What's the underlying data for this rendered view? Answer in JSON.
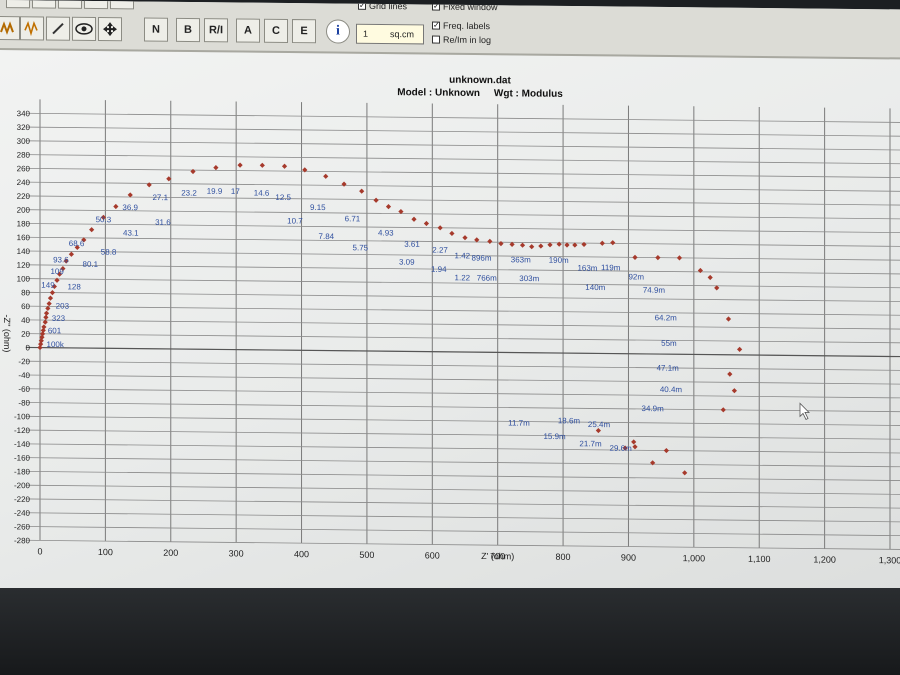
{
  "toolbar": {
    "unit_value": "1",
    "unit_label": "sq.cm",
    "grid_lines_label": "Grid lines",
    "fixed_window_label": "Fixed window",
    "freq_labels_label": "Freq. labels",
    "reim_log_label": "Re/Im in log",
    "button_labels": [
      "N",
      "B",
      "R/I",
      "A",
      "C",
      "E"
    ],
    "info_label": "i"
  },
  "chart_data": {
    "type": "scatter",
    "title": "unknown.dat",
    "subtitle": "Model : Unknown     Wgt : Modulus",
    "xlabel": "Z' (ohm)",
    "ylabel": "-Z'' (ohm)",
    "xlim": [
      0,
      1300
    ],
    "ylim": [
      -280,
      340
    ],
    "grid": true,
    "marker_color": "#a63a2c",
    "label_color": "#2f4f9f",
    "xticks": [
      "0",
      "100",
      "200",
      "300",
      "400",
      "500",
      "600",
      "700",
      "800",
      "900",
      "1,000",
      "1,100",
      "1,200",
      "1,300"
    ],
    "yticks": [
      "340",
      "320",
      "300",
      "280",
      "260",
      "240",
      "220",
      "200",
      "180",
      "160",
      "140",
      "120",
      "100",
      "80",
      "60",
      "40",
      "20",
      "0",
      "-20",
      "-40",
      "-60",
      "-80",
      "-100",
      "-120",
      "-140",
      "-160",
      "-180",
      "-200",
      "-220",
      "-240",
      "-260",
      "-280"
    ],
    "points": [
      [
        0,
        0
      ],
      [
        1,
        5
      ],
      [
        2,
        10
      ],
      [
        3,
        15
      ],
      [
        4,
        20
      ],
      [
        5,
        25
      ],
      [
        6,
        30
      ],
      [
        8,
        37
      ],
      [
        9,
        44
      ],
      [
        10,
        50
      ],
      [
        12,
        57
      ],
      [
        14,
        64
      ],
      [
        16,
        72
      ],
      [
        19,
        80
      ],
      [
        22,
        89
      ],
      [
        26,
        98
      ],
      [
        30,
        107
      ],
      [
        35,
        115
      ],
      [
        40,
        126
      ],
      [
        48,
        136
      ],
      [
        57,
        146
      ],
      [
        67,
        157
      ],
      [
        79,
        172
      ],
      [
        97,
        190
      ],
      [
        116,
        206
      ],
      [
        138,
        223
      ],
      [
        167,
        238
      ],
      [
        197,
        247
      ],
      [
        234,
        258
      ],
      [
        269,
        264
      ],
      [
        306,
        268
      ],
      [
        340,
        268
      ],
      [
        374,
        267
      ],
      [
        405,
        262
      ],
      [
        437,
        253
      ],
      [
        465,
        242
      ],
      [
        492,
        232
      ],
      [
        514,
        219
      ],
      [
        533,
        210
      ],
      [
        552,
        203
      ],
      [
        572,
        192
      ],
      [
        591,
        186
      ],
      [
        612,
        180
      ],
      [
        630,
        172
      ],
      [
        650,
        166
      ],
      [
        668,
        163
      ],
      [
        688,
        161
      ],
      [
        705,
        158
      ],
      [
        722,
        157
      ],
      [
        738,
        156
      ],
      [
        752,
        154
      ],
      [
        766,
        155
      ],
      [
        780,
        157
      ],
      [
        794,
        158
      ],
      [
        806,
        157
      ],
      [
        818,
        157
      ],
      [
        832,
        158
      ],
      [
        860,
        160
      ],
      [
        876,
        161
      ],
      [
        910,
        140
      ],
      [
        945,
        140
      ],
      [
        978,
        140
      ],
      [
        1010,
        122
      ],
      [
        1025,
        112
      ],
      [
        1035,
        97
      ],
      [
        1053,
        52
      ],
      [
        1070,
        8
      ],
      [
        1055,
        -28
      ],
      [
        1062,
        -52
      ],
      [
        1045,
        -80
      ],
      [
        854,
        -112
      ],
      [
        895,
        -137
      ],
      [
        908,
        -128
      ],
      [
        910,
        -135
      ],
      [
        937,
        -158
      ],
      [
        958,
        -140
      ],
      [
        986,
        -172
      ]
    ],
    "data_labels": [
      {
        "text": "100k",
        "x": 10,
        "y": 1
      },
      {
        "text": "601",
        "x": 12,
        "y": 21
      },
      {
        "text": "323",
        "x": 18,
        "y": 39
      },
      {
        "text": "203",
        "x": 24,
        "y": 57
      },
      {
        "text": "149",
        "x": 2,
        "y": 87
      },
      {
        "text": "128",
        "x": 42,
        "y": 85
      },
      {
        "text": "109",
        "x": 16,
        "y": 107
      },
      {
        "text": "93.6",
        "x": 20,
        "y": 124
      },
      {
        "text": "80.1",
        "x": 65,
        "y": 118
      },
      {
        "text": "68.6",
        "x": 44,
        "y": 148
      },
      {
        "text": "58.8",
        "x": 93,
        "y": 136
      },
      {
        "text": "50.3",
        "x": 85,
        "y": 183
      },
      {
        "text": "43.1",
        "x": 127,
        "y": 164
      },
      {
        "text": "36.9",
        "x": 126,
        "y": 201
      },
      {
        "text": "31.6",
        "x": 176,
        "y": 180
      },
      {
        "text": "27.1",
        "x": 172,
        "y": 216
      },
      {
        "text": "23.2",
        "x": 216,
        "y": 223
      },
      {
        "text": "19.9",
        "x": 255,
        "y": 226
      },
      {
        "text": "17",
        "x": 292,
        "y": 226
      },
      {
        "text": "14.6",
        "x": 327,
        "y": 224
      },
      {
        "text": "12.5",
        "x": 360,
        "y": 218
      },
      {
        "text": "10.7",
        "x": 378,
        "y": 184
      },
      {
        "text": "9.15",
        "x": 413,
        "y": 204
      },
      {
        "text": "7.84",
        "x": 426,
        "y": 162
      },
      {
        "text": "6.71",
        "x": 466,
        "y": 188
      },
      {
        "text": "5.75",
        "x": 478,
        "y": 146
      },
      {
        "text": "4.93",
        "x": 517,
        "y": 168
      },
      {
        "text": "3.61",
        "x": 557,
        "y": 152
      },
      {
        "text": "3.09",
        "x": 549,
        "y": 126
      },
      {
        "text": "2.27",
        "x": 600,
        "y": 144
      },
      {
        "text": "1.94",
        "x": 598,
        "y": 116
      },
      {
        "text": "1.42",
        "x": 634,
        "y": 136
      },
      {
        "text": "1.22",
        "x": 634,
        "y": 104
      },
      {
        "text": "896m",
        "x": 660,
        "y": 133
      },
      {
        "text": "766m",
        "x": 668,
        "y": 104
      },
      {
        "text": "363m",
        "x": 720,
        "y": 131
      },
      {
        "text": "303m",
        "x": 733,
        "y": 104
      },
      {
        "text": "190m",
        "x": 778,
        "y": 131
      },
      {
        "text": "163m",
        "x": 822,
        "y": 120
      },
      {
        "text": "140m",
        "x": 834,
        "y": 92
      },
      {
        "text": "119m",
        "x": 858,
        "y": 121
      },
      {
        "text": "92m",
        "x": 900,
        "y": 108
      },
      {
        "text": "74.9m",
        "x": 922,
        "y": 89
      },
      {
        "text": "64.2m",
        "x": 940,
        "y": 49
      },
      {
        "text": "55m",
        "x": 950,
        "y": 12
      },
      {
        "text": "47.1m",
        "x": 943,
        "y": -24
      },
      {
        "text": "40.4m",
        "x": 948,
        "y": -55
      },
      {
        "text": "34.9m",
        "x": 920,
        "y": -83
      },
      {
        "text": "11.7m",
        "x": 716,
        "y": -106
      },
      {
        "text": "18.6m",
        "x": 792,
        "y": -102
      },
      {
        "text": "25.4m",
        "x": 838,
        "y": -107
      },
      {
        "text": "15.9m",
        "x": 770,
        "y": -125
      },
      {
        "text": "21.7m",
        "x": 825,
        "y": -135
      },
      {
        "text": "29.6m",
        "x": 871,
        "y": -141
      }
    ]
  }
}
